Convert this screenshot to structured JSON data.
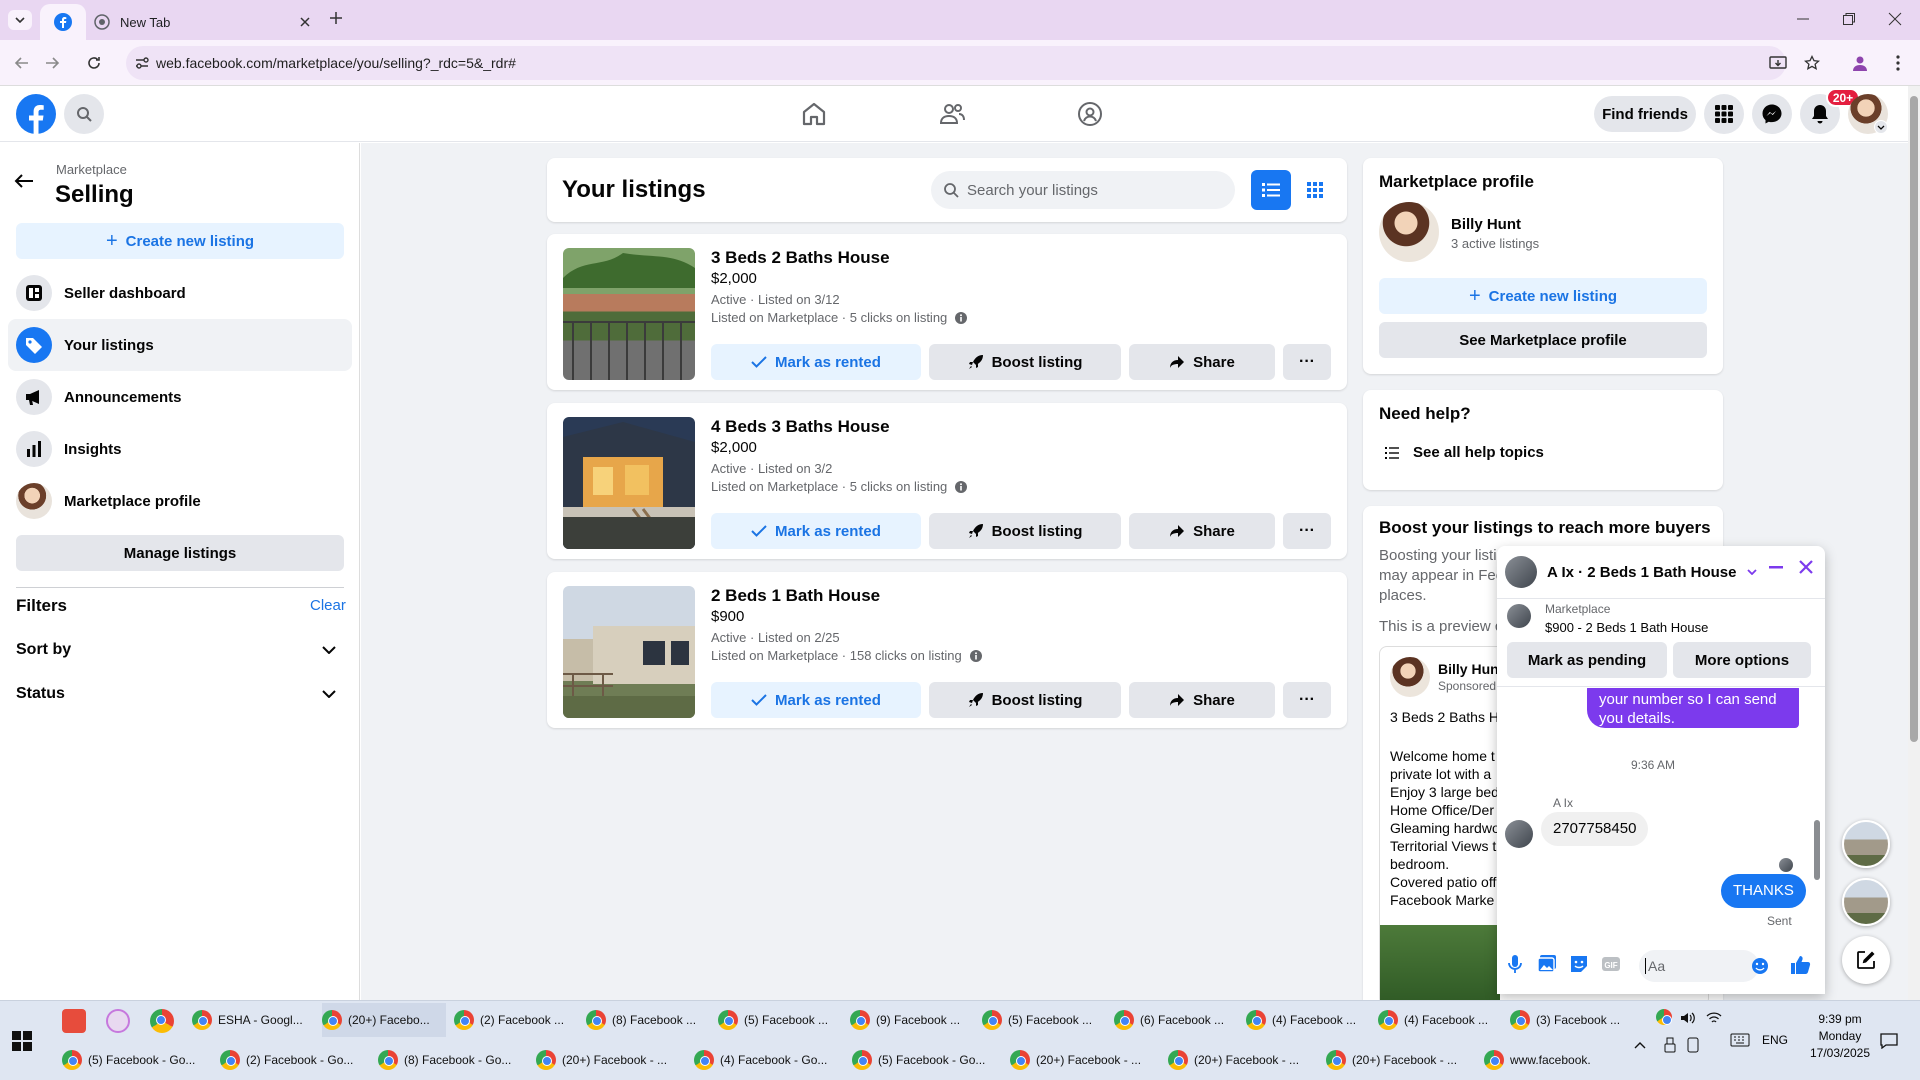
{
  "browser": {
    "tabs": [
      {
        "label": ""
      },
      {
        "label": "New Tab"
      }
    ],
    "url": "web.facebook.com/marketplace/you/selling?_rdc=5&_rdr#"
  },
  "header": {
    "find_friends": "Find friends",
    "notif_badge": "20+"
  },
  "sidebar": {
    "section": "Marketplace",
    "title": "Selling",
    "create_listing": "Create new listing",
    "items": [
      {
        "label": "Seller dashboard",
        "icon": "dashboard-icon"
      },
      {
        "label": "Your listings",
        "icon": "tag-icon"
      },
      {
        "label": "Announcements",
        "icon": "megaphone-icon"
      },
      {
        "label": "Insights",
        "icon": "bar-chart-icon"
      },
      {
        "label": "Marketplace profile",
        "icon": "avatar"
      }
    ],
    "manage_listings": "Manage listings",
    "filters": "Filters",
    "clear": "Clear",
    "sort_by": "Sort by",
    "status": "Status"
  },
  "listings_panel": {
    "title": "Your listings",
    "search_placeholder": "Search your listings"
  },
  "listings": [
    {
      "title": "3 Beds 2 Baths House",
      "price": "$2,000",
      "status": "Active · Listed on 3/12",
      "meta": "Listed on Marketplace · 5 clicks on listing"
    },
    {
      "title": "4 Beds 3 Baths House",
      "price": "$2,000",
      "status": "Active · Listed on 3/2",
      "meta": "Listed on Marketplace · 5 clicks on listing"
    },
    {
      "title": "2 Beds 1 Bath House",
      "price": "$900",
      "status": "Active · Listed on 2/25",
      "meta": "Listed on Marketplace · 158 clicks on listing"
    }
  ],
  "listing_actions": {
    "mark_rented": "Mark as rented",
    "boost": "Boost listing",
    "share": "Share",
    "more": "···"
  },
  "profile_card": {
    "title": "Marketplace profile",
    "name": "Billy Hunt",
    "active": "3 active listings",
    "create": "Create new listing",
    "see_profile": "See Marketplace profile"
  },
  "help_card": {
    "title": "Need help?",
    "link": "See all help topics"
  },
  "boost_card": {
    "title": "Boost your listings to reach more buyers",
    "body1": "Boosting your listi",
    "body2": "may appear in Fee",
    "body3": "places.",
    "preview": "This is a preview c",
    "ad_name": "Billy Hun",
    "ad_sponsored": "Sponsored",
    "ad_title": "3 Beds 2 Baths H",
    "ad_lines": [
      "Welcome home t",
      "private lot with a",
      "Enjoy 3 large bed",
      "Home Office/Der",
      "Gleaming hardwo",
      "Territorial Views t",
      "bedroom.",
      "Covered patio off",
      "Facebook Marke"
    ]
  },
  "chat": {
    "header": "A Ix · 2 Beds 1 Bath House",
    "context_label": "Marketplace",
    "context_item": "$900 - 2 Beds 1 Bath House",
    "mark_pending": "Mark as pending",
    "more_options": "More options",
    "msg_out1_line1": "your number so I can send",
    "msg_out1_line2": "you details.",
    "time": "9:36 AM",
    "sender": "A Ix",
    "msg_in": "2707758450",
    "msg_out2": "THANKS",
    "sent": "Sent",
    "input_placeholder": "Aa"
  },
  "taskbar": {
    "row1": [
      "ESHA - Googl...",
      "(20+) Facebo...",
      "(2) Facebook ...",
      "(8) Facebook ...",
      "(5) Facebook ...",
      "(9) Facebook ...",
      "(5) Facebook ...",
      "(6) Facebook ...",
      "(4) Facebook ...",
      "(4) Facebook ...",
      "(3) Facebook ..."
    ],
    "row2": [
      "(5) Facebook - Go...",
      "(2) Facebook - Go...",
      "(8) Facebook - Go...",
      "(20+) Facebook - ...",
      "(4) Facebook - Go...",
      "(5) Facebook - Go...",
      "(20+) Facebook - ...",
      "(20+) Facebook - ...",
      "(20+) Facebook - ...",
      "www.facebook.co..."
    ],
    "lang": "ENG",
    "time": "9:39 pm",
    "day": "Monday",
    "date": "17/03/2025"
  },
  "colors": {
    "fb_blue": "#1877f2",
    "messenger_purple": "#7c3aed",
    "bg": "#f0f2f5"
  }
}
